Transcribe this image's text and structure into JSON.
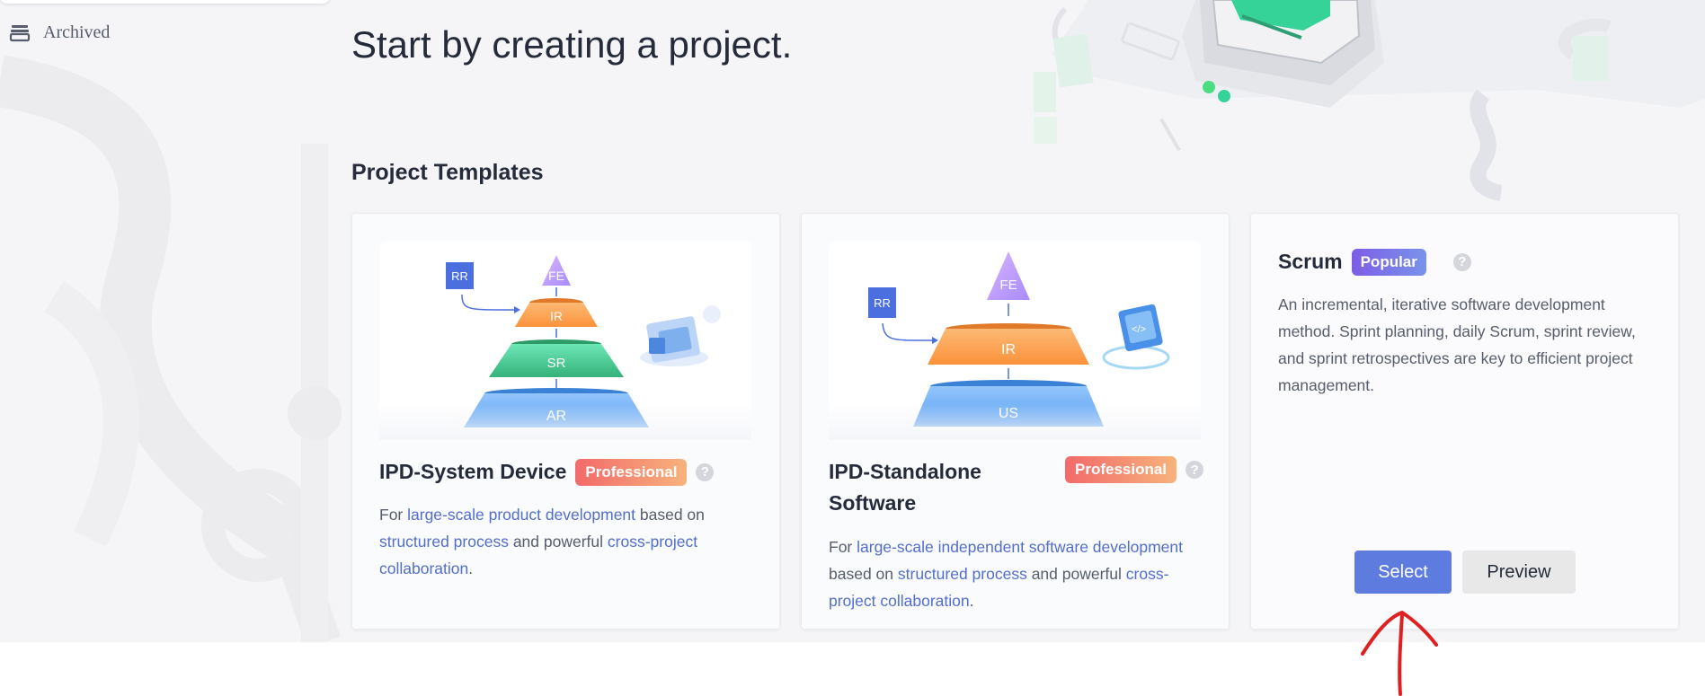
{
  "sidebar": {
    "archived_label": "Archived"
  },
  "hero": {
    "title": "Start by creating a project."
  },
  "templates": {
    "section_title": "Project Templates",
    "cards": [
      {
        "title": "IPD-System Device",
        "badge": "Professional",
        "pyramid_labels": [
          "RR",
          "FE",
          "IR",
          "SR",
          "AR"
        ],
        "desc": [
          {
            "t": "For ",
            "hl": false
          },
          {
            "t": "large-scale product development",
            "hl": true
          },
          {
            "t": " based on ",
            "hl": false
          },
          {
            "t": "structured process",
            "hl": true
          },
          {
            "t": " and powerful ",
            "hl": false
          },
          {
            "t": "cross-project collaboration",
            "hl": true
          },
          {
            "t": ".",
            "hl": false
          }
        ]
      },
      {
        "title_line1": "IPD-Standalone",
        "title_line2": "Software",
        "badge": "Professional",
        "pyramid_labels": [
          "RR",
          "FE",
          "IR",
          "US"
        ],
        "desc": [
          {
            "t": "For ",
            "hl": false
          },
          {
            "t": "large-scale independent software development",
            "hl": true
          },
          {
            "t": " based on ",
            "hl": false
          },
          {
            "t": "structured process",
            "hl": true
          },
          {
            "t": " and powerful ",
            "hl": false
          },
          {
            "t": "cross-project collaboration",
            "hl": true
          },
          {
            "t": ".",
            "hl": false
          }
        ]
      },
      {
        "title": "Scrum",
        "badge": "Popular",
        "description": "An incremental, iterative software development method. Sprint planning, daily Scrum, sprint review, and sprint retrospectives are key to efficient project management.",
        "select_label": "Select",
        "preview_label": "Preview"
      }
    ]
  },
  "colors": {
    "accent": "#5e7ce0",
    "link": "#526ecc",
    "annotation": "#e02020"
  }
}
